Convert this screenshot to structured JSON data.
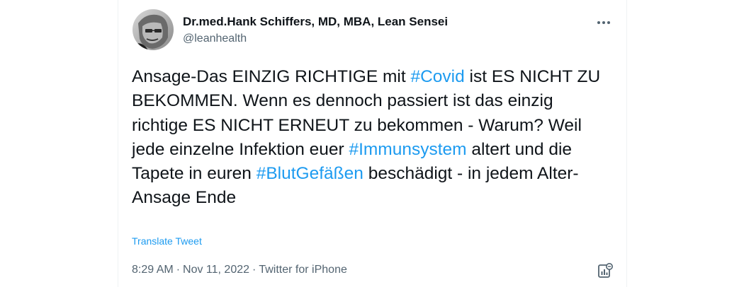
{
  "author": {
    "display_name": "Dr.med.Hank Schiffers, MD, MBA, Lean Sensei",
    "handle": "@leanhealth"
  },
  "tweet": {
    "segments": [
      {
        "text": "Ansage-Das EINZIG RICHTIGE mit ",
        "hashtag": false
      },
      {
        "text": "#Covid",
        "hashtag": true
      },
      {
        "text": " ist ES NICHT ZU BEKOMMEN. Wenn es dennoch passiert ist das einzig richtige ES NICHT ERNEUT zu bekommen - Warum? Weil jede einzelne Infektion euer ",
        "hashtag": false
      },
      {
        "text": "#Immunsystem",
        "hashtag": true
      },
      {
        "text": " altert und die Tapete in euren ",
        "hashtag": false
      },
      {
        "text": "#BlutGefäßen",
        "hashtag": true
      },
      {
        "text": " beschädigt - in jedem Alter-Ansage Ende",
        "hashtag": false
      }
    ],
    "translate_label": "Translate Tweet"
  },
  "meta": {
    "time": "8:29 AM",
    "separator": "·",
    "date": "Nov 11, 2022",
    "source": "Twitter for iPhone"
  },
  "icons": {
    "more": "more-horizontal-icon",
    "analytics": "view-analytics-icon"
  },
  "colors": {
    "text": "#0f1419",
    "secondary": "#536471",
    "link": "#1d9bf0"
  }
}
